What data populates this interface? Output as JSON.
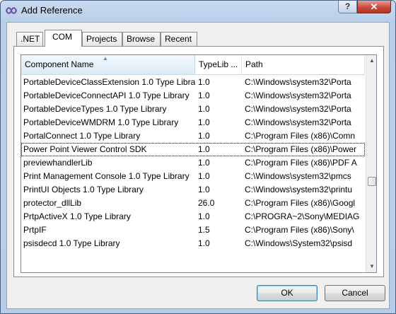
{
  "window": {
    "title": "Add Reference",
    "help_label": "?",
    "close_label": "✕"
  },
  "tabs": [
    {
      "label": ".NET",
      "active": false
    },
    {
      "label": "COM",
      "active": true
    },
    {
      "label": "Projects",
      "active": false
    },
    {
      "label": "Browse",
      "active": false
    },
    {
      "label": "Recent",
      "active": false
    }
  ],
  "list": {
    "columns": [
      "Component Name",
      "TypeLib ...",
      "Path"
    ],
    "sort_indicator": "▲",
    "rows": [
      {
        "name": "PortableDeviceClassExtension 1.0 Type Libra...",
        "version": "1.0",
        "path": "C:\\Windows\\system32\\Porta"
      },
      {
        "name": "PortableDeviceConnectAPI 1.0 Type Library",
        "version": "1.0",
        "path": "C:\\Windows\\system32\\Porta"
      },
      {
        "name": "PortableDeviceTypes 1.0 Type Library",
        "version": "1.0",
        "path": "C:\\Windows\\system32\\Porta"
      },
      {
        "name": "PortableDeviceWMDRM 1.0 Type Library",
        "version": "1.0",
        "path": "C:\\Windows\\system32\\Porta"
      },
      {
        "name": "PortalConnect 1.0 Type Library",
        "version": "1.0",
        "path": "C:\\Program Files (x86)\\Comn"
      },
      {
        "name": "Power Point Viewer Control SDK",
        "version": "1.0",
        "path": "C:\\Program Files (x86)\\Power",
        "selected": true
      },
      {
        "name": "previewhandlerLib",
        "version": "1.0",
        "path": "C:\\Program Files (x86)\\PDF A"
      },
      {
        "name": "Print Management Console 1.0 Type Library",
        "version": "1.0",
        "path": "C:\\Windows\\system32\\pmcs"
      },
      {
        "name": "PrintUI Objects 1.0 Type Library",
        "version": "1.0",
        "path": "C:\\Windows\\system32\\printu"
      },
      {
        "name": "protector_dllLib",
        "version": "26.0",
        "path": "C:\\Program Files (x86)\\Googl"
      },
      {
        "name": "PrtpActiveX 1.0 Type Library",
        "version": "1.0",
        "path": "C:\\PROGRA~2\\Sony\\MEDIAG"
      },
      {
        "name": "PrtpIF",
        "version": "1.5",
        "path": "C:\\Program Files (x86)\\Sony\\"
      },
      {
        "name": "psisdecd 1.0 Type Library",
        "version": "1.0",
        "path": "C:\\Windows\\System32\\psisd"
      }
    ]
  },
  "scrollbar": {
    "up_arrow": "▲",
    "down_arrow": "▼",
    "position_fraction": 0.6
  },
  "buttons": {
    "ok": "OK",
    "cancel": "Cancel"
  }
}
